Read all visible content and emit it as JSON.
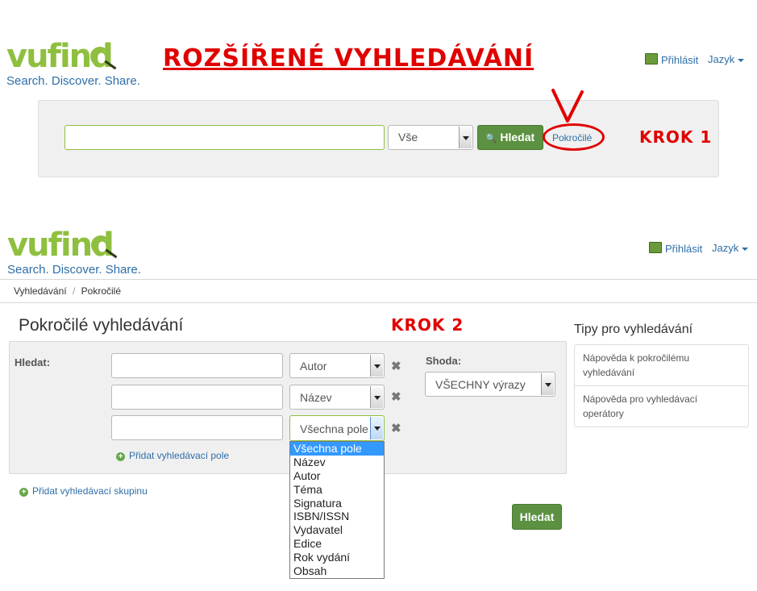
{
  "heading": "ROZŠÍŘENÉ VYHLEDÁVÁNÍ",
  "logo": {
    "word": "vufind",
    "tagline": "Search. Discover. Share."
  },
  "header": {
    "login": "Přihlásit",
    "language": "Jazyk"
  },
  "step1": {
    "label": "KROK 1",
    "search_value": "",
    "type_select": "Vše",
    "search_button": "Hledat",
    "advanced_link": "Pokročilé"
  },
  "breadcrumb": {
    "home": "Vyhledávání",
    "separator": "/",
    "current": "Pokročilé"
  },
  "step2": {
    "label": "KROK 2",
    "page_title": "Pokročilé vyhledávání",
    "search_label": "Hledat:",
    "rows": [
      {
        "value": "",
        "field": "Autor"
      },
      {
        "value": "",
        "field": "Název"
      },
      {
        "value": "",
        "field": "Všechna pole"
      }
    ],
    "match_label": "Shoda:",
    "match_value": "VŠECHNY výrazy",
    "add_field": "Přidat vyhledávací pole",
    "add_group": "Přidat vyhledávací skupinu",
    "search_button": "Hledat",
    "dropdown_options": [
      "Všechna pole",
      "Název",
      "Autor",
      "Téma",
      "Signatura",
      "ISBN/ISSN",
      "Vydavatel",
      "Edice",
      "Rok vydání",
      "Obsah"
    ],
    "dropdown_selected": "Všechna pole"
  },
  "tips": {
    "title": "Tipy pro vyhledávání",
    "items": [
      "Nápověda k pokročilému vyhledávání",
      "Nápověda pro vyhledávací operátory"
    ]
  },
  "colors": {
    "accent_green": "#5b9140",
    "logo_green": "#8fbf3f",
    "link_blue": "#2e6ea7",
    "annotation_red": "#e00000"
  }
}
